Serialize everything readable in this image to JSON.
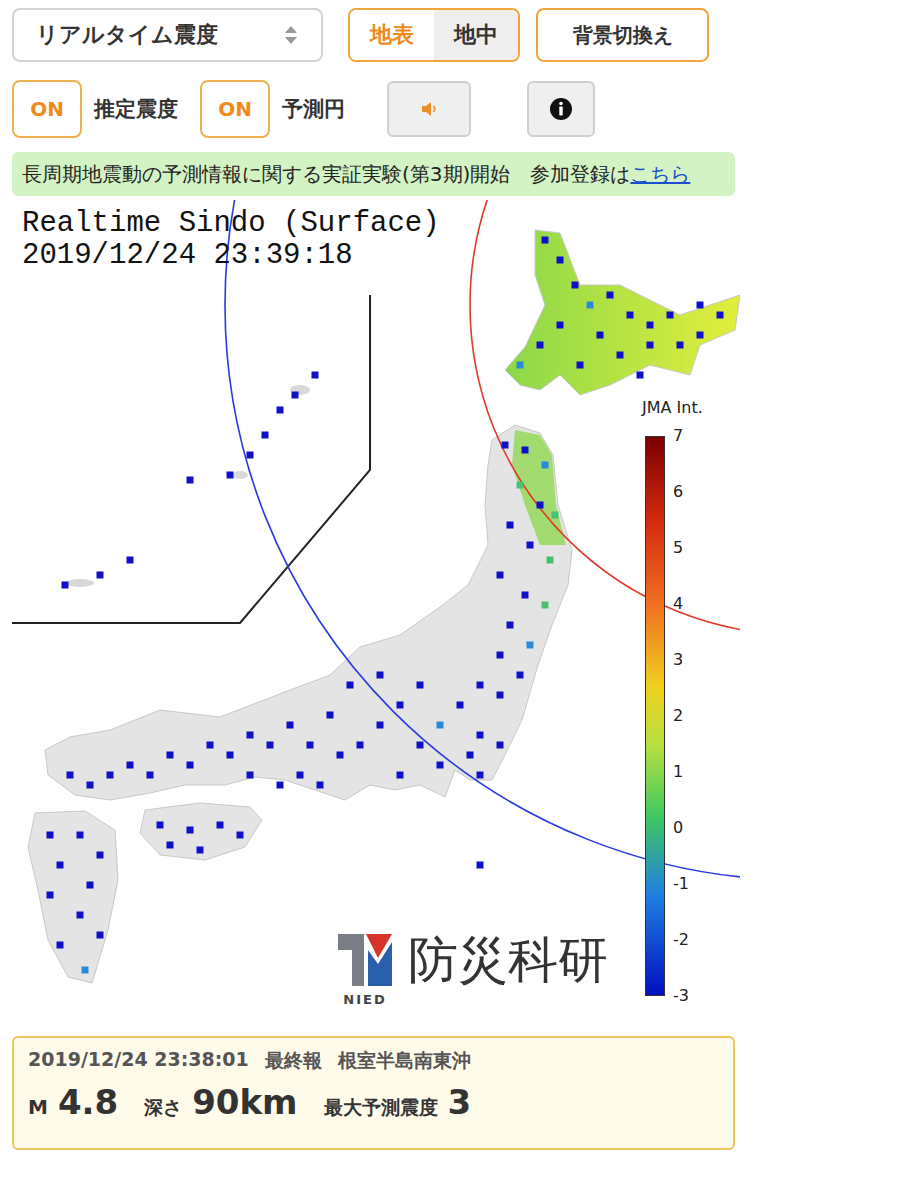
{
  "controls": {
    "mode_select": {
      "label": "リアルタイム震度"
    },
    "layer_tabs": [
      {
        "label": "地表",
        "selected": true
      },
      {
        "label": "地中",
        "selected": false
      }
    ],
    "background_button": "背景切換え",
    "toggles": [
      {
        "state": "ON",
        "label": "推定震度",
        "on": true
      },
      {
        "state": "ON",
        "label": "予測円",
        "on": true
      }
    ]
  },
  "banner": {
    "text": "長周期地震動の予測情報に関する実証実験(第3期)開始　参加登録は",
    "link": "こちら"
  },
  "map": {
    "title": "Realtime Sindo (Surface)",
    "time": "2019/12/24 23:39:18",
    "estimate_colors": [
      "#8bd84a",
      "#e2ee3c"
    ],
    "circles": [
      {
        "kind": "s-wave",
        "color": "#e03a2a"
      },
      {
        "kind": "p-wave",
        "color": "#2a3ae0"
      }
    ],
    "stations": [
      {
        "color": "#1010c8"
      },
      {
        "color": "#1010c8"
      },
      {
        "color": "#1010c8"
      },
      {
        "color": "#2a8ad8"
      },
      {
        "color": "#1010c8"
      },
      {
        "color": "#1010c8"
      },
      {
        "color": "#1010c8"
      },
      {
        "color": "#1010c8"
      },
      {
        "color": "#1010c8"
      },
      {
        "color": "#1010c8"
      },
      {
        "color": "#1010c8"
      },
      {
        "color": "#1010c8"
      },
      {
        "color": "#1010c8"
      },
      {
        "color": "#1010c8"
      },
      {
        "color": "#1010c8"
      },
      {
        "color": "#1010c8"
      },
      {
        "color": "#2a8ad8"
      },
      {
        "color": "#1010c8"
      },
      {
        "color": "#1010c8"
      },
      {
        "color": "#1010c8"
      },
      {
        "color": "#1010c8"
      },
      {
        "color": "#1010c8"
      },
      {
        "color": "#2a8ad8"
      },
      {
        "color": "#4cc070"
      },
      {
        "color": "#1010c8"
      },
      {
        "color": "#4cc070"
      },
      {
        "color": "#1010c8"
      },
      {
        "color": "#1010c8"
      },
      {
        "color": "#4cc070"
      },
      {
        "color": "#1010c8"
      },
      {
        "color": "#1010c8"
      },
      {
        "color": "#4cc070"
      },
      {
        "color": "#1010c8"
      },
      {
        "color": "#2a8ad8"
      },
      {
        "color": "#1010c8"
      },
      {
        "color": "#1010c8"
      },
      {
        "color": "#1010c8"
      },
      {
        "color": "#1010c8"
      },
      {
        "color": "#1010c8"
      },
      {
        "color": "#2a8ad8"
      },
      {
        "color": "#1010c8"
      },
      {
        "color": "#1010c8"
      },
      {
        "color": "#1010c8"
      },
      {
        "color": "#1010c8"
      },
      {
        "color": "#1010c8"
      },
      {
        "color": "#1010c8"
      },
      {
        "color": "#1010c8"
      },
      {
        "color": "#1010c8"
      },
      {
        "color": "#1010c8"
      },
      {
        "color": "#1010c8"
      },
      {
        "color": "#1010c8"
      },
      {
        "color": "#1010c8"
      },
      {
        "color": "#1010c8"
      },
      {
        "color": "#1010c8"
      },
      {
        "color": "#1010c8"
      },
      {
        "color": "#1010c8"
      },
      {
        "color": "#1010c8"
      },
      {
        "color": "#1010c8"
      },
      {
        "color": "#1010c8"
      },
      {
        "color": "#1010c8"
      },
      {
        "color": "#1010c8"
      },
      {
        "color": "#1010c8"
      },
      {
        "color": "#1010c8"
      },
      {
        "color": "#1010c8"
      },
      {
        "color": "#1010c8"
      },
      {
        "color": "#1010c8"
      },
      {
        "color": "#1010c8"
      },
      {
        "color": "#1010c8"
      },
      {
        "color": "#1010c8"
      },
      {
        "color": "#1010c8"
      },
      {
        "color": "#1010c8"
      },
      {
        "color": "#1010c8"
      },
      {
        "color": "#1010c8"
      },
      {
        "color": "#1010c8"
      },
      {
        "color": "#1010c8"
      },
      {
        "color": "#1010c8"
      },
      {
        "color": "#1010c8"
      },
      {
        "color": "#1010c8"
      },
      {
        "color": "#1010c8"
      },
      {
        "color": "#1010c8"
      },
      {
        "color": "#1010c8"
      },
      {
        "color": "#1010c8"
      },
      {
        "color": "#1010c8"
      },
      {
        "color": "#1010c8"
      },
      {
        "color": "#1010c8"
      },
      {
        "color": "#1010c8"
      },
      {
        "color": "#1010c8"
      },
      {
        "color": "#2a8ad8"
      },
      {
        "color": "#1010c8"
      },
      {
        "color": "#1010c8"
      },
      {
        "color": "#1010c8"
      },
      {
        "color": "#1010c8"
      },
      {
        "color": "#1010c8"
      },
      {
        "color": "#1010c8"
      },
      {
        "color": "#1010c8"
      },
      {
        "color": "#1010c8"
      },
      {
        "color": "#1010c8"
      },
      {
        "color": "#1010c8"
      },
      {
        "color": "#1010c8"
      }
    ]
  },
  "legend": {
    "title": "JMA Int.",
    "ticks": [
      "7",
      "6",
      "5",
      "4",
      "3",
      "2",
      "1",
      "0",
      "-1",
      "-2",
      "-3"
    ]
  },
  "logo": {
    "abbr": "NIED",
    "name": "防災科研"
  },
  "quake": {
    "time": "2019/12/24 23:38:01",
    "report": "最終報",
    "region": "根室半島南東沖",
    "magnitude_label": "M",
    "magnitude": "4.8",
    "depth_label": "深さ",
    "depth": "90km",
    "max_label": "最大予測震度",
    "max": "3"
  }
}
